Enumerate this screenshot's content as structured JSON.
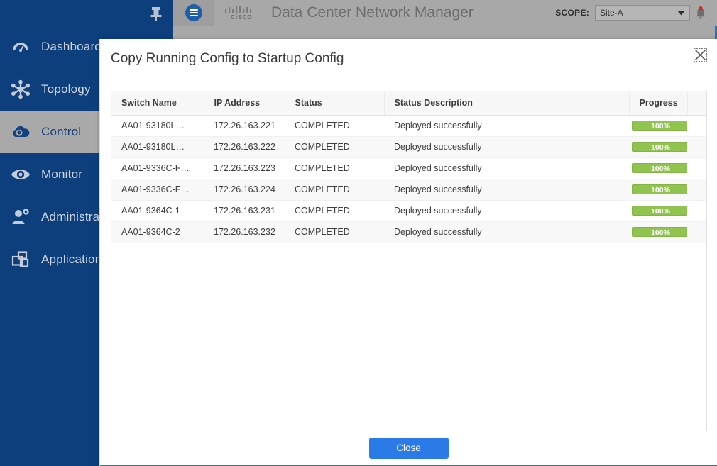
{
  "topbar": {
    "logo_bars": "ıl۰ılı۰",
    "logo_word": "cisco",
    "app_title": "Data Center Network Manager",
    "scope_label": "SCOPE:",
    "scope_value": "Site-A",
    "menu_icon": "hamburger-menu-icon",
    "bell_icon": "notification-bell-icon"
  },
  "sidebar": {
    "pin_icon": "pushpin-icon",
    "items": [
      {
        "label": "Dashboard",
        "icon": "gauge-icon",
        "active": false
      },
      {
        "label": "Topology",
        "icon": "network-nodes-icon",
        "active": false
      },
      {
        "label": "Control",
        "icon": "cloud-control-icon",
        "active": true
      },
      {
        "label": "Monitor",
        "icon": "eye-icon",
        "active": false
      },
      {
        "label": "Administration",
        "icon": "user-gear-icon",
        "active": false
      },
      {
        "label": "Applications",
        "icon": "stacked-windows-icon",
        "active": false
      }
    ]
  },
  "modal": {
    "title": "Copy Running Config to Startup Config",
    "close_icon": "close-x-icon",
    "close_button_label": "Close",
    "table": {
      "columns": [
        "Switch Name",
        "IP Address",
        "Status",
        "Status Description",
        "Progress",
        ""
      ],
      "rows": [
        {
          "switch": "AA01-93180L…",
          "ip": "172.26.163.221",
          "status": "COMPLETED",
          "description": "Deployed successfully",
          "progress": "100%"
        },
        {
          "switch": "AA01-93180L…",
          "ip": "172.26.163.222",
          "status": "COMPLETED",
          "description": "Deployed successfully",
          "progress": "100%"
        },
        {
          "switch": "AA01-9336C-F…",
          "ip": "172.26.163.223",
          "status": "COMPLETED",
          "description": "Deployed successfully",
          "progress": "100%"
        },
        {
          "switch": "AA01-9336C-F…",
          "ip": "172.26.163.224",
          "status": "COMPLETED",
          "description": "Deployed successfully",
          "progress": "100%"
        },
        {
          "switch": "AA01-9364C-1",
          "ip": "172.26.163.231",
          "status": "COMPLETED",
          "description": "Deployed successfully",
          "progress": "100%"
        },
        {
          "switch": "AA01-9364C-2",
          "ip": "172.26.163.232",
          "status": "COMPLETED",
          "description": "Deployed successfully",
          "progress": "100%"
        }
      ]
    }
  },
  "colors": {
    "sidebar_blue": "#0d3f7c",
    "active_gray": "#a9a9a9",
    "topbar_gray": "#a8a8a8",
    "progress_green": "#91c34f",
    "primary_blue": "#2a7ae8",
    "accent_edge_blue": "#2f6fb5"
  }
}
